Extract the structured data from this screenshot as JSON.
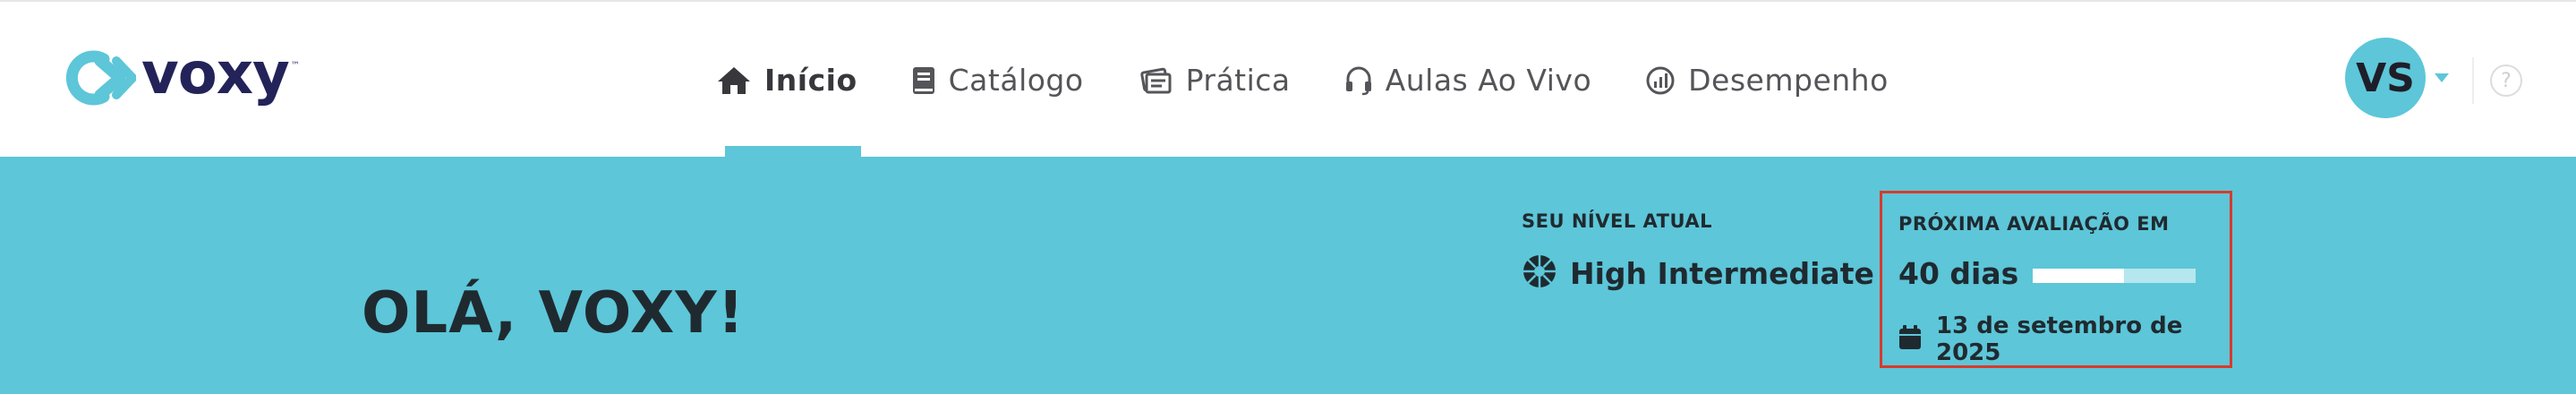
{
  "brand": {
    "name": "voxy",
    "trademark": "™",
    "colors": {
      "navy": "#23235a",
      "teal": "#5dc6d8"
    }
  },
  "nav": {
    "items": [
      {
        "label": "Início",
        "icon": "home-icon",
        "active": true
      },
      {
        "label": "Catálogo",
        "icon": "book-icon",
        "active": false
      },
      {
        "label": "Prática",
        "icon": "practice-cards-icon",
        "active": false
      },
      {
        "label": "Aulas Ao Vivo",
        "icon": "headset-icon",
        "active": false
      },
      {
        "label": "Desempenho",
        "icon": "performance-chart-icon",
        "active": false
      }
    ]
  },
  "user": {
    "initials": "VS"
  },
  "help": {
    "symbol": "?"
  },
  "banner": {
    "greeting": "OLÁ, VOXY!",
    "level": {
      "label": "SEU NÍVEL ATUAL",
      "value": "High Intermediate"
    },
    "assessment": {
      "label": "PRÓXIMA AVALIAÇÃO EM",
      "days": "40 dias",
      "progress": 0.56,
      "date": "13 de setembro de 2025"
    },
    "colors": {
      "background": "#5dc6d8",
      "highlight_border": "#d93a2b"
    }
  }
}
